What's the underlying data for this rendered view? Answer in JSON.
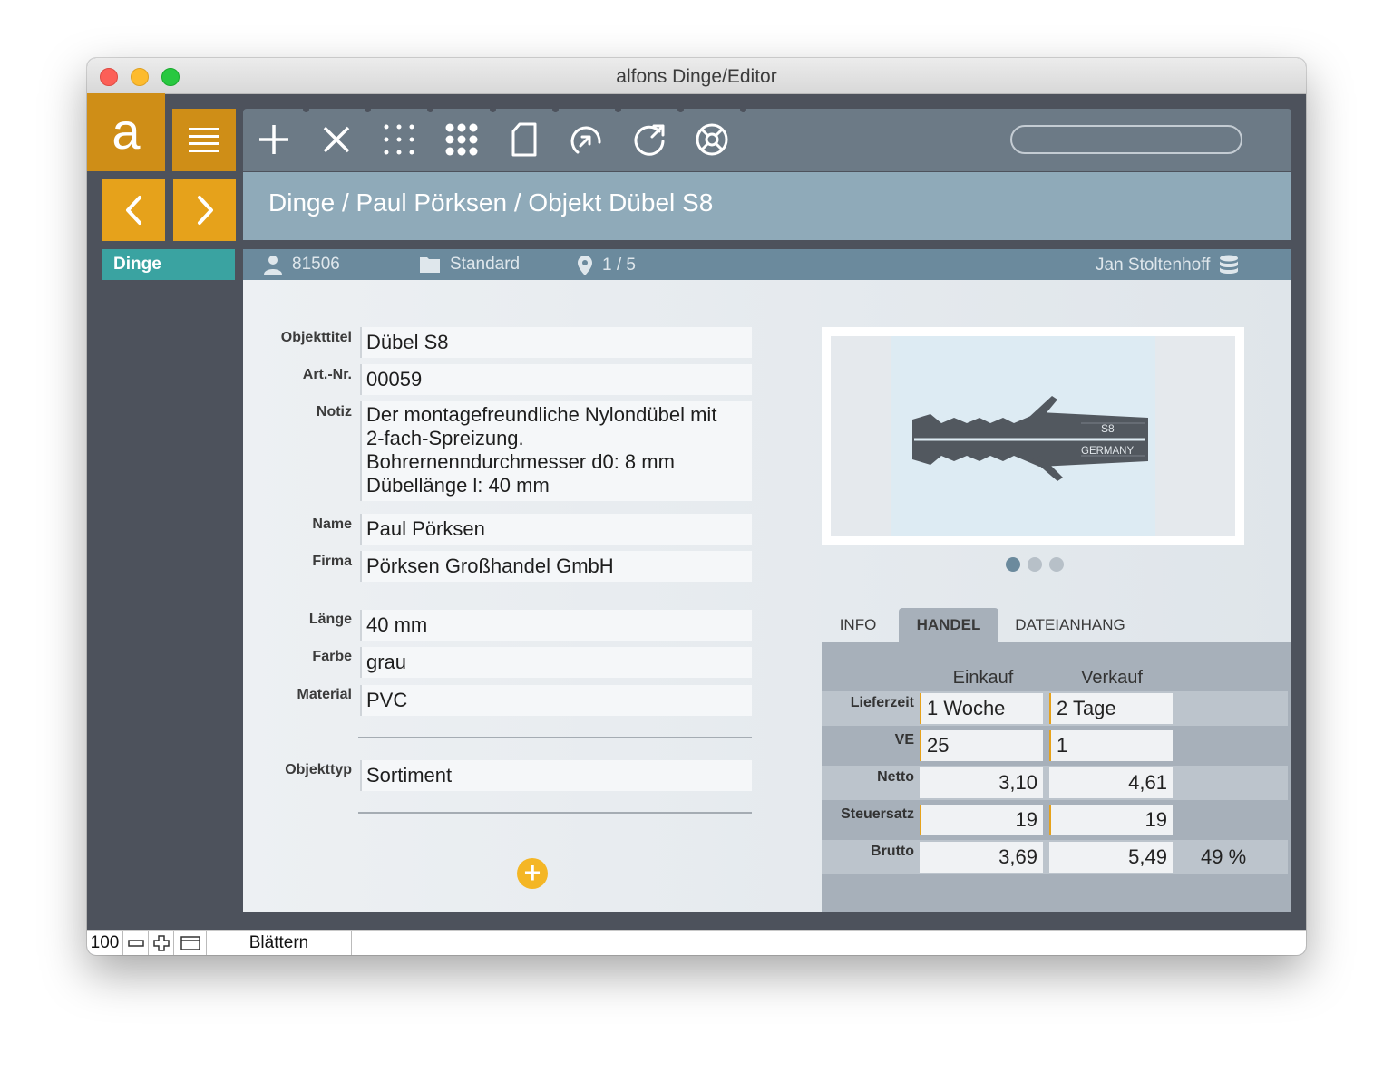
{
  "window": {
    "title": "alfons Dinge/Editor"
  },
  "app": {
    "logo_letter": "a"
  },
  "breadcrumb": "Dinge / Paul Pörksen / Objekt Dübel S8",
  "sidebar": {
    "active_item": "Dinge"
  },
  "toolbar": {
    "icons": [
      "plus-icon",
      "close-icon",
      "small-grid-icon",
      "large-grid-icon",
      "document-icon",
      "undo-icon",
      "refresh-icon",
      "help-icon"
    ],
    "search_placeholder": ""
  },
  "infobar": {
    "customer_id": "81506",
    "folder": "Standard",
    "position": "1 / 5",
    "user": "Jan Stoltenhoff"
  },
  "form": {
    "objekttitel": {
      "label": "Objekttitel",
      "value": "Dübel S8"
    },
    "artnr": {
      "label": "Art.-Nr.",
      "value": "00059"
    },
    "notiz": {
      "label": "Notiz",
      "lines": [
        "Der montagefreundliche Nylondübel mit",
        "2-fach-Spreizung.",
        "Bohrernenndurchmesser d0: 8 mm",
        "Dübellänge l: 40 mm"
      ]
    },
    "name": {
      "label": "Name",
      "value": "Paul Pörksen"
    },
    "firma": {
      "label": "Firma",
      "value": "Pörksen Großhandel GmbH"
    },
    "laenge": {
      "label": "Länge",
      "value": "40 mm"
    },
    "farbe": {
      "label": "Farbe",
      "value": "grau"
    },
    "material": {
      "label": "Material",
      "value": "PVC"
    },
    "objekttyp": {
      "label": "Objekttyp",
      "value": "Sortiment"
    }
  },
  "image": {
    "text_s8": "S8",
    "text_germany": "GERMANY",
    "pages": 3,
    "current_page": 1
  },
  "tabs": [
    {
      "label": "INFO",
      "active": false
    },
    {
      "label": "HANDEL",
      "active": true
    },
    {
      "label": "DATEIANHANG",
      "active": false
    }
  ],
  "handel": {
    "col_einkauf": "Einkauf",
    "col_verkauf": "Verkauf",
    "rows": [
      {
        "label": "Lieferzeit",
        "einkauf": "1 Woche",
        "verkauf": "2 Tage",
        "extra": ""
      },
      {
        "label": "VE",
        "einkauf": "25",
        "verkauf": "1",
        "extra": ""
      },
      {
        "label": "Netto",
        "einkauf": "3,10",
        "verkauf": "4,61",
        "extra": ""
      },
      {
        "label": "Steuersatz",
        "einkauf": "19",
        "verkauf": "19",
        "extra": ""
      },
      {
        "label": "Brutto",
        "einkauf": "3,69",
        "verkauf": "5,49",
        "extra": "49 %"
      }
    ]
  },
  "statusbar": {
    "zoom": "100",
    "mode": "Blättern"
  },
  "colors": {
    "accent": "#e6a21b",
    "teal": "#3aa3a1",
    "toolbar": "#6c7a86",
    "breadcrumb": "#8faab9"
  }
}
